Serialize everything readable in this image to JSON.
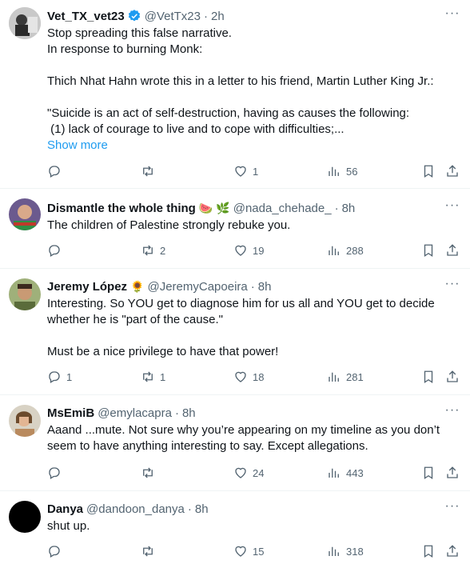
{
  "tweets": [
    {
      "name": "Vet_TX_vet23",
      "handle": "@VetTx23",
      "time": "2h",
      "lines": [
        "Stop spreading this false narrative.",
        "In response to burning Monk:",
        "",
        "Thich Nhat Hahn wrote this in a letter to his friend, Martin Luther King Jr.:",
        "",
        "\"Suicide is an act of self-destruction, having as causes the following:",
        " (1) lack of courage to live and to cope with difficulties;..."
      ],
      "show_more": "Show more",
      "replies": "",
      "retweets": "",
      "likes": "1",
      "views": "56"
    },
    {
      "name": "Dismantle the whole thing",
      "handle": "@nada_chehade_",
      "time": "8h",
      "lines": [
        "The children of Palestine strongly rebuke you."
      ],
      "replies": "",
      "retweets": "2",
      "likes": "19",
      "views": "288"
    },
    {
      "name": "Jeremy López",
      "handle": "@JeremyCapoeira",
      "time": "8h",
      "lines": [
        "Interesting. So YOU get to diagnose him for us all and YOU get to decide",
        "whether he is \"part of the cause.\"",
        "",
        "Must be a nice privilege to have that power!"
      ],
      "replies": "1",
      "retweets": "1",
      "likes": "18",
      "views": "281"
    },
    {
      "name": "MsEmiB",
      "handle": "@emylacapra",
      "time": "8h",
      "lines": [
        "Aaand ...mute. Not sure why you’re appearing on my timeline as you don’t",
        "seem to have anything interesting to say. Except allegations."
      ],
      "replies": "",
      "retweets": "",
      "likes": "24",
      "views": "443"
    },
    {
      "name": "Danya",
      "handle": "@dandoon_danya",
      "time": "8h",
      "lines": [
        "shut up."
      ],
      "replies": "",
      "retweets": "",
      "likes": "15",
      "views": "318"
    }
  ],
  "separator": "·",
  "colors": {
    "accent": "#1d9bf0",
    "text": "#0f1419",
    "muted": "#536471",
    "border": "#eff3f4"
  }
}
